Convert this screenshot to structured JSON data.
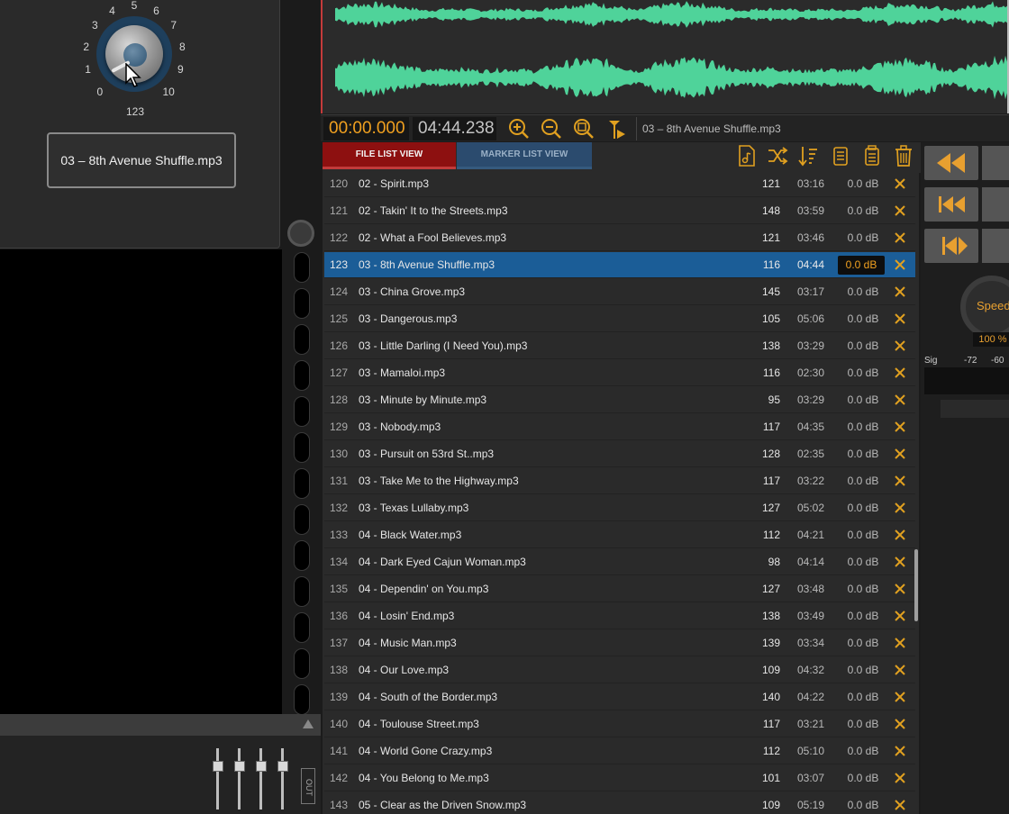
{
  "knob": {
    "ticks": [
      "0",
      "1",
      "2",
      "3",
      "4",
      "5",
      "6",
      "7",
      "8",
      "9",
      "10"
    ],
    "value": "123"
  },
  "current_file": "03 – 8th Avenue Shuffle.mp3",
  "out_label": "OUT",
  "timebar": {
    "current_time": "00:00.000",
    "total_time": "04:44.238",
    "title": "03 – 8th Avenue Shuffle.mp3",
    "icons": [
      "zoom-in-icon",
      "zoom-out-icon",
      "zoom-fit-icon",
      "marker-play-icon"
    ]
  },
  "tabs": {
    "file_list": "FILE LIST VIEW",
    "marker_list": "MARKER LIST VIEW"
  },
  "toolbar_icons": [
    "add-file-icon",
    "shuffle-icon",
    "sort-icon",
    "copy-list-icon",
    "paste-list-icon",
    "trash-icon"
  ],
  "list": {
    "rows": [
      {
        "num": "120",
        "name": "02 - Spirit.mp3",
        "bpm": "121",
        "dur": "03:16",
        "gain": "0.0 dB"
      },
      {
        "num": "121",
        "name": "02 - Takin' It to the Streets.mp3",
        "bpm": "148",
        "dur": "03:59",
        "gain": "0.0 dB"
      },
      {
        "num": "122",
        "name": "02 - What a Fool Believes.mp3",
        "bpm": "121",
        "dur": "03:46",
        "gain": "0.0 dB"
      },
      {
        "num": "123",
        "name": "03 - 8th Avenue Shuffle.mp3",
        "bpm": "116",
        "dur": "04:44",
        "gain": "0.0 dB",
        "selected": true
      },
      {
        "num": "124",
        "name": "03 - China Grove.mp3",
        "bpm": "145",
        "dur": "03:17",
        "gain": "0.0 dB"
      },
      {
        "num": "125",
        "name": "03 - Dangerous.mp3",
        "bpm": "105",
        "dur": "05:06",
        "gain": "0.0 dB"
      },
      {
        "num": "126",
        "name": "03 - Little Darling (I Need You).mp3",
        "bpm": "138",
        "dur": "03:29",
        "gain": "0.0 dB"
      },
      {
        "num": "127",
        "name": "03 - Mamaloi.mp3",
        "bpm": "116",
        "dur": "02:30",
        "gain": "0.0 dB"
      },
      {
        "num": "128",
        "name": "03 - Minute by Minute.mp3",
        "bpm": "95",
        "dur": "03:29",
        "gain": "0.0 dB"
      },
      {
        "num": "129",
        "name": "03 - Nobody.mp3",
        "bpm": "117",
        "dur": "04:35",
        "gain": "0.0 dB"
      },
      {
        "num": "130",
        "name": "03 - Pursuit on 53rd St..mp3",
        "bpm": "128",
        "dur": "02:35",
        "gain": "0.0 dB"
      },
      {
        "num": "131",
        "name": "03 - Take Me to the Highway.mp3",
        "bpm": "117",
        "dur": "03:22",
        "gain": "0.0 dB"
      },
      {
        "num": "132",
        "name": "03 - Texas Lullaby.mp3",
        "bpm": "127",
        "dur": "05:02",
        "gain": "0.0 dB"
      },
      {
        "num": "133",
        "name": "04 - Black Water.mp3",
        "bpm": "112",
        "dur": "04:21",
        "gain": "0.0 dB"
      },
      {
        "num": "134",
        "name": "04 - Dark Eyed Cajun Woman.mp3",
        "bpm": "98",
        "dur": "04:14",
        "gain": "0.0 dB"
      },
      {
        "num": "135",
        "name": "04 - Dependin' on You.mp3",
        "bpm": "127",
        "dur": "03:48",
        "gain": "0.0 dB"
      },
      {
        "num": "136",
        "name": "04 - Losin' End.mp3",
        "bpm": "138",
        "dur": "03:49",
        "gain": "0.0 dB"
      },
      {
        "num": "137",
        "name": "04 - Music Man.mp3",
        "bpm": "139",
        "dur": "03:34",
        "gain": "0.0 dB"
      },
      {
        "num": "138",
        "name": "04 - Our Love.mp3",
        "bpm": "109",
        "dur": "04:32",
        "gain": "0.0 dB"
      },
      {
        "num": "139",
        "name": "04 - South of the Border.mp3",
        "bpm": "140",
        "dur": "04:22",
        "gain": "0.0 dB"
      },
      {
        "num": "140",
        "name": "04 - Toulouse Street.mp3",
        "bpm": "117",
        "dur": "03:21",
        "gain": "0.0 dB"
      },
      {
        "num": "141",
        "name": "04 - World Gone Crazy.mp3",
        "bpm": "112",
        "dur": "05:10",
        "gain": "0.0 dB"
      },
      {
        "num": "142",
        "name": "04 - You Belong to Me.mp3",
        "bpm": "101",
        "dur": "03:07",
        "gain": "0.0 dB"
      },
      {
        "num": "143",
        "name": "05 - Clear as the Driven Snow.mp3",
        "bpm": "109",
        "dur": "05:19",
        "gain": "0.0 dB"
      }
    ]
  },
  "right_panel": {
    "speed_label": "Speed",
    "speed_value": "100 %",
    "sig_label": "Sig",
    "db_labels": [
      "-72",
      "-60"
    ]
  },
  "colors": {
    "waveform": "#4fd39a",
    "accent_orange": "#f0a020",
    "selected_row": "#1b5d97",
    "file_tab": "#8d1010",
    "marker_tab": "#2b4b6e"
  }
}
